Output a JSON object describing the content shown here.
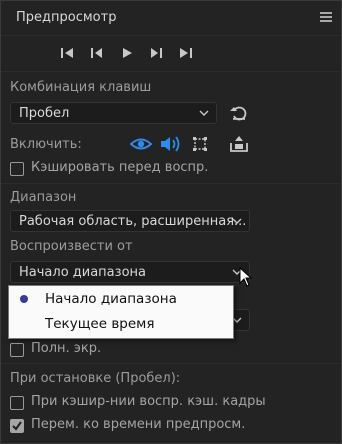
{
  "panel": {
    "title": "Предпросмотр"
  },
  "transport": {
    "buttons": [
      "skip-to-start",
      "step-back",
      "play",
      "step-forward",
      "skip-to-end"
    ]
  },
  "shortcut": {
    "label": "Комбинация клавиш",
    "value": "Пробел"
  },
  "enable": {
    "label": "Включить:"
  },
  "cache_before_play": {
    "label": "Кэшировать перед воспр.",
    "checked": false
  },
  "range": {
    "label": "Диапазон",
    "value": "Рабочая область, расширенная..."
  },
  "play_from": {
    "label": "Воспроизвести от",
    "value": "Начало диапазона"
  },
  "play_from_menu": {
    "options": [
      "Начало диапазона",
      "Текущее время"
    ],
    "selected": "Начало диапазона"
  },
  "fullscreen": {
    "label": "Полн. экр.",
    "checked": false
  },
  "on_stop": {
    "label": "При остановке (Пробел):"
  },
  "if_caching": {
    "label": "При кэшир-нии воспр. кэш. кадры",
    "checked": false
  },
  "move_time": {
    "label": "Перем. ко времени предпросм.",
    "checked": true
  },
  "colors": {
    "accent_blue": "#2d8ceb",
    "background": "#232323"
  }
}
